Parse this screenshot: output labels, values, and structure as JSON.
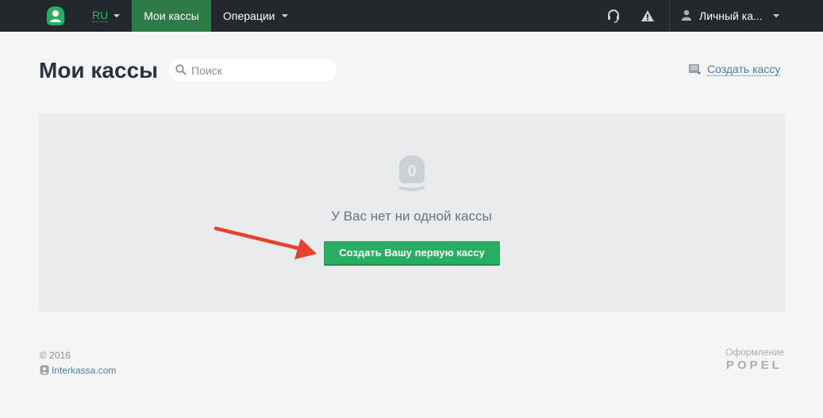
{
  "topbar": {
    "lang": "RU",
    "nav_active": "Мои кассы",
    "nav_operations": "Операции",
    "user": "Личный ка..."
  },
  "header": {
    "title": "Мои кассы",
    "search_placeholder": "Поиск",
    "create_link": "Создать кассу"
  },
  "empty": {
    "icon_digit": "0",
    "message": "У Вас нет ни одной кассы",
    "button": "Создать Вашу первую кассу"
  },
  "footer": {
    "copyright": "© 2016",
    "site": "Interkassa.com",
    "design_label": "Оформление",
    "design_brand": "POPEL"
  },
  "colors": {
    "topbar": "#23282d",
    "accent": "#27ae60",
    "active_tab": "#2f7b47",
    "link": "#4a7eb0",
    "annotation_arrow": "#e8412c"
  }
}
